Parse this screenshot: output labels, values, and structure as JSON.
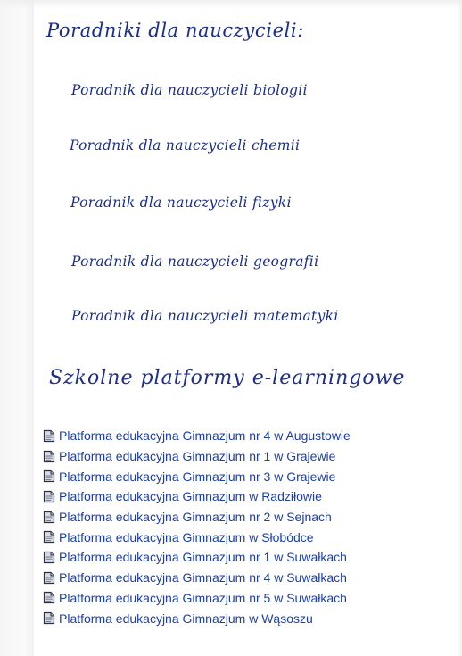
{
  "teacher_guides": {
    "heading": "Poradniki dla nauczycieli:",
    "items": [
      {
        "label": "Poradnik dla nauczycieli biologii"
      },
      {
        "label": "Poradnik dla nauczycieli chemii"
      },
      {
        "label": "Poradnik dla nauczycieli fizyki"
      },
      {
        "label": "Poradnik dla nauczycieli geografii"
      },
      {
        "label": "Poradnik dla nauczycieli matematyki"
      }
    ]
  },
  "platforms": {
    "heading": "Szkolne platformy e-learningowe",
    "icon": "document-icon",
    "items": [
      {
        "label": "Platforma edukacyjna Gimnazjum nr 4 w Augustowie"
      },
      {
        "label": "Platforma edukacyjna Gimnazjum nr 1 w Grajewie"
      },
      {
        "label": "Platforma edukacyjna Gimnazjum nr 3 w Grajewie"
      },
      {
        "label": "Platforma edukacyjna Gimnazjum w Radziłowie"
      },
      {
        "label": "Platforma edukacyjna Gimnazjum nr 2 w Sejnach"
      },
      {
        "label": "Platforma edukacyjna Gimnazjum w Słobódce"
      },
      {
        "label": "Platforma edukacyjna Gimnazjum nr 1 w Suwałkach"
      },
      {
        "label": "Platforma edukacyjna Gimnazjum nr 4 w Suwałkach"
      },
      {
        "label": "Platforma edukacyjna Gimnazjum nr 5 w Suwałkach"
      },
      {
        "label": "Platforma edukacyjna Gimnazjum w Wąsoszu"
      }
    ]
  },
  "colors": {
    "heading": "#1b2f86",
    "link": "#1b3fa8",
    "background": "#ffffff"
  }
}
